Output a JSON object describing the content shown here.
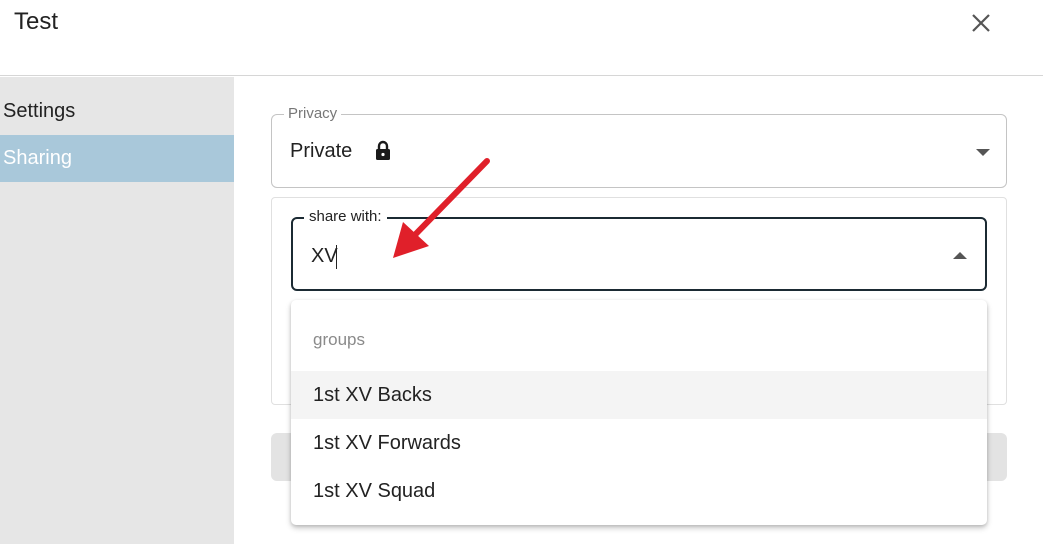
{
  "dialog": {
    "title": "Test"
  },
  "sidebar": {
    "items": [
      {
        "label": "Settings"
      },
      {
        "label": "Sharing"
      }
    ]
  },
  "privacy": {
    "legend": "Privacy",
    "value": "Private",
    "icon": "lock-icon"
  },
  "share": {
    "legend": "share with:",
    "value": "XV"
  },
  "menu": {
    "group_header": "groups",
    "options": [
      {
        "label": "1st XV Backs"
      },
      {
        "label": "1st XV Forwards"
      },
      {
        "label": "1st XV Squad"
      }
    ]
  },
  "colors": {
    "sidebar_bg": "#e6e6e6",
    "sidebar_active": "#a9c8da",
    "annotation_arrow": "#e0202a"
  }
}
